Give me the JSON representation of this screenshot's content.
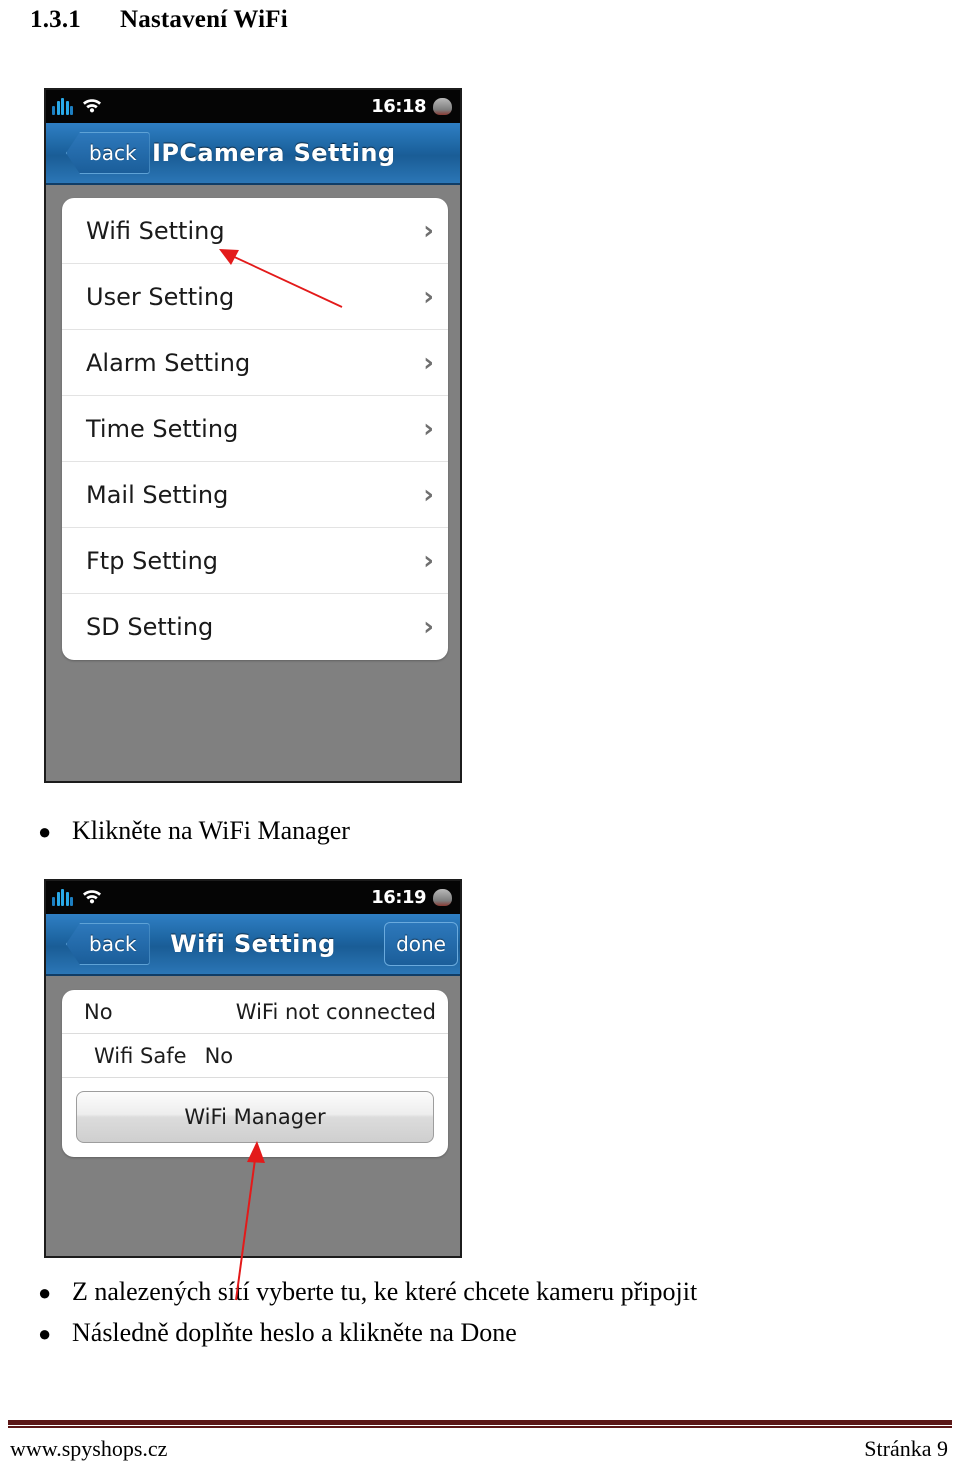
{
  "document": {
    "heading_number": "1.3.1",
    "heading_title": "Nastavení WiFi"
  },
  "screenshot_one": {
    "status_bar": {
      "signal_icon": "signal-bars-icon",
      "wifi_icon": "wifi-icon",
      "time": "16:18",
      "battery_icon": "battery-icon"
    },
    "nav_bar": {
      "back_label": "back",
      "title": "IPCamera Setting"
    },
    "menu_items": [
      {
        "label": "Wifi Setting",
        "chevron": "›"
      },
      {
        "label": "User Setting",
        "chevron": "›"
      },
      {
        "label": "Alarm Setting",
        "chevron": "›"
      },
      {
        "label": "Time Setting",
        "chevron": "›"
      },
      {
        "label": "Mail Setting",
        "chevron": "›"
      },
      {
        "label": "Ftp Setting",
        "chevron": "›"
      },
      {
        "label": "SD Setting",
        "chevron": "›"
      }
    ]
  },
  "screenshot_two": {
    "status_bar": {
      "signal_icon": "signal-bars-icon",
      "wifi_icon": "wifi-icon",
      "time": "16:19",
      "battery_icon": "battery-icon"
    },
    "nav_bar": {
      "back_label": "back",
      "title": "Wifi Setting",
      "done_label": "done"
    },
    "rows": {
      "status_key": "No",
      "status_value": "WiFi not connected",
      "safe_key": "Wifi Safe",
      "safe_value": "No"
    },
    "manager_button": "WiFi Manager"
  },
  "annotations": {
    "arrow_color": "#e31a1a",
    "arrow_one_target": "Wifi Setting",
    "arrow_two_target": "WiFi Manager"
  },
  "bullets": [
    "Klikněte na WiFi Manager",
    "Z nalezených sítí vyberte tu, ke které chcete kameru připojit",
    "Následně doplňte heslo a klikněte na Done"
  ],
  "bullet_marker": "●",
  "footer": {
    "website": "www.spyshops.cz",
    "page": "Stránka 9",
    "rule_color": "#5b1717"
  }
}
